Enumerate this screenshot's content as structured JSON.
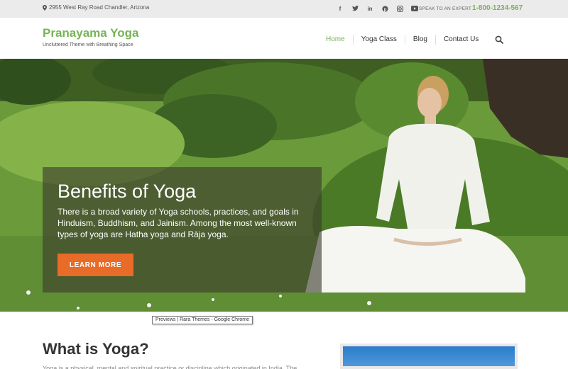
{
  "topbar": {
    "address": "2955 West Ray Road Chandler, Arizona",
    "socials": [
      "facebook-icon",
      "twitter-icon",
      "linkedin-icon",
      "pinterest-icon",
      "instagram-icon",
      "youtube-icon"
    ],
    "speak_label": "SPEAK TO AN EXPERT",
    "phone": "1-800-1234-567"
  },
  "header": {
    "site_title": "Pranayama Yoga",
    "tagline": "Uncluttered Theme with Breathing Space",
    "nav": [
      "Home",
      "Yoga Class",
      "Blog",
      "Contact Us"
    ],
    "active": "Home"
  },
  "hero": {
    "title": "Benefits of Yoga",
    "text": "There is a broad variety of Yoga schools, practices, and goals in Hinduism, Buddhism, and Jainism. Among the most well-known types of yoga are Hatha yoga and Rāja yoga.",
    "button": "LEARN MORE"
  },
  "tooltip": "Previews | Rara Themes - Google Chrome",
  "content": {
    "heading": "What is Yoga?",
    "paragraph": "Yoga is a physical, mental and spiritual practice or discipline which originated in India. The"
  },
  "colors": {
    "accent": "#77b356",
    "button": "#e86b27",
    "topbar": "#ebebeb"
  }
}
